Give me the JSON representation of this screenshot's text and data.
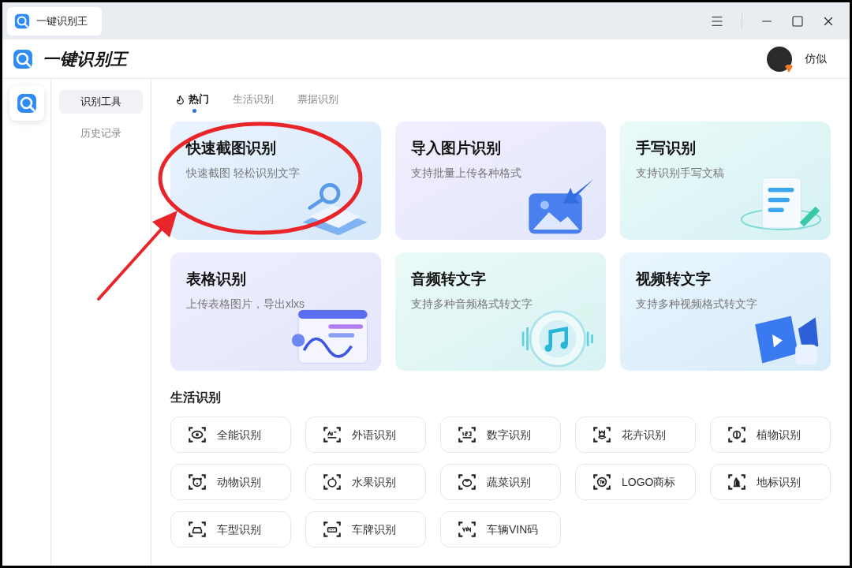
{
  "window": {
    "tab_title": "一键识别王"
  },
  "header": {
    "brand": "一键识别王",
    "user_name": "仿似"
  },
  "nav": [
    {
      "label": "识别工具",
      "selected": true
    },
    {
      "label": "历史记录",
      "selected": false
    }
  ],
  "tabs": [
    {
      "label": "热门",
      "selected": true
    },
    {
      "label": "生活识别",
      "selected": false
    },
    {
      "label": "票据识别",
      "selected": false
    }
  ],
  "cards": [
    {
      "kind": "screenshot",
      "title": "快速截图识别",
      "subtitle": "快速截图 轻松识别文字"
    },
    {
      "kind": "image",
      "title": "导入图片识别",
      "subtitle": "支持批量上传各种格式"
    },
    {
      "kind": "handwriting",
      "title": "手写识别",
      "subtitle": "支持识别手写文稿"
    },
    {
      "kind": "table",
      "title": "表格识别",
      "subtitle": "上传表格图片，导出xlxs"
    },
    {
      "kind": "audio",
      "title": "音频转文字",
      "subtitle": "支持多种音频格式转文字"
    },
    {
      "kind": "video",
      "title": "视频转文字",
      "subtitle": "支持多种视频格式转文字"
    }
  ],
  "section": {
    "title": "生活识别"
  },
  "tools": [
    {
      "kind": "eye",
      "label": "全能识别"
    },
    {
      "kind": "letters",
      "label": "外语识别"
    },
    {
      "kind": "digits",
      "label": "数字识别"
    },
    {
      "kind": "flower",
      "label": "花卉识别"
    },
    {
      "kind": "plant",
      "label": "植物识别"
    },
    {
      "kind": "animal",
      "label": "动物识别"
    },
    {
      "kind": "fruit",
      "label": "水果识别"
    },
    {
      "kind": "vegetable",
      "label": "蔬菜识别"
    },
    {
      "kind": "trademark",
      "label": "LOGO商标"
    },
    {
      "kind": "landmark",
      "label": "地标识别"
    },
    {
      "kind": "car",
      "label": "车型识别"
    },
    {
      "kind": "plate",
      "label": "车牌识别"
    },
    {
      "kind": "code",
      "label": "车辆VIN码"
    }
  ]
}
